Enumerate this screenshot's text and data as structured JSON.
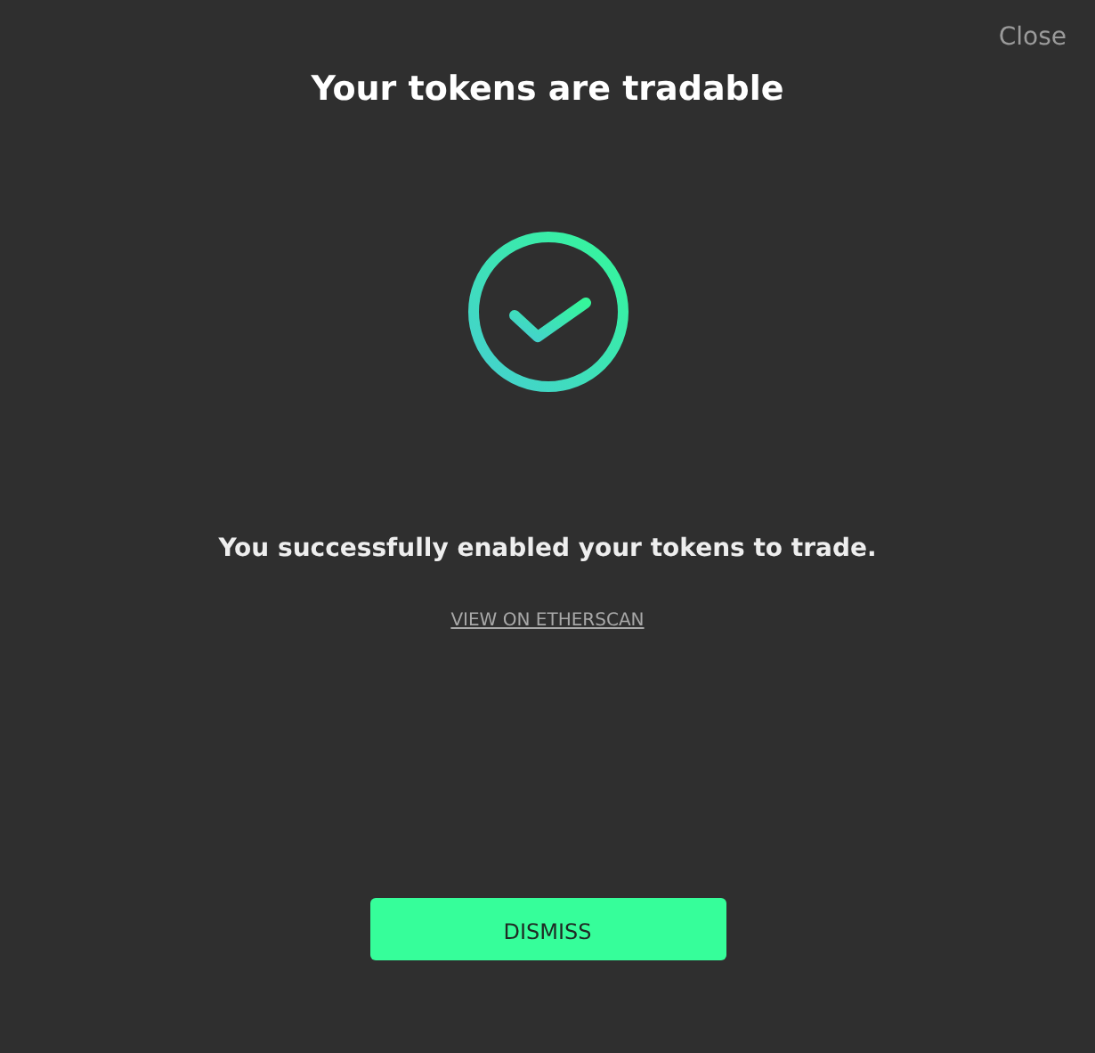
{
  "close_button": "Close",
  "title": "Your tokens are tradable",
  "message": "You successfully enabled your tokens to trade.",
  "etherscan_link": "VIEW ON ETHERSCAN",
  "dismiss_button": "DISMISS"
}
